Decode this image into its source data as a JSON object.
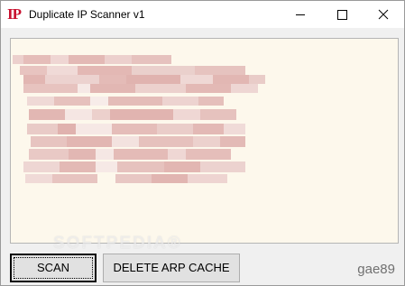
{
  "window": {
    "app_icon_text": "IP",
    "title": "Duplicate IP Scanner v1",
    "minimize_glyph": "minimize-icon",
    "maximize_glyph": "maximize-icon",
    "close_glyph": "close-icon"
  },
  "output_panel": {
    "background": "#fdf8ec",
    "content_pixelated": true
  },
  "buttons": {
    "scan_label": "SCAN",
    "delete_arp_label": "DELETE ARP CACHE"
  },
  "author_label": "gae89",
  "watermark": "SOFTPEDIA®",
  "colors": {
    "icon_red": "#c8102e",
    "blur_pink": "#e3b8b5"
  }
}
